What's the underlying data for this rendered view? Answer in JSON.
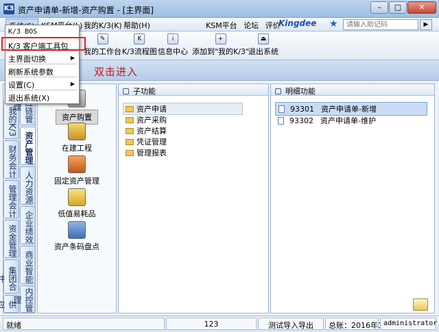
{
  "window": {
    "title": "资产申请单-新增-资产购置 - [主界面]",
    "app_icon": "K3",
    "buttons": {
      "minimize": "–",
      "maximize": "□",
      "close": "✕"
    }
  },
  "menubar": {
    "items": [
      "系统(S)",
      "KSM平台(L)",
      "我的K/3(K)",
      "帮助(H)"
    ],
    "links": [
      "KSM平台",
      "论坛",
      "评价"
    ],
    "brand": "Kingdee",
    "help_placeholder": "请输入助记码"
  },
  "dropdown": {
    "items": [
      {
        "label": "K/3 BOS",
        "submenu": false
      },
      {
        "label": "K/3 客户端工具包",
        "submenu": false
      },
      {
        "label": "主界面切换",
        "submenu": true
      },
      {
        "label": "刷新系统参数",
        "submenu": false
      },
      {
        "label": "设置(C)",
        "submenu": true
      },
      {
        "label": "退出系统(X)",
        "submenu": false
      }
    ]
  },
  "toolbar": {
    "items": [
      "我的工作台",
      "K/3流程图",
      "信息中心",
      "添加到\"我的K/3\"",
      "退出系统"
    ]
  },
  "annotation": "双击进入",
  "left_tabs": {
    "col1": [
      "我的K/3",
      "财务会计",
      "管理会计",
      "资金管理",
      "集团合并",
      "供应链"
    ],
    "col2": [
      "资产管理",
      "人力资源",
      "企业绩效",
      "商业智能",
      "内控管理"
    ],
    "top": "供应链管理"
  },
  "modules": [
    "资产购置",
    "在建工程",
    "固定资产管理",
    "低值易耗品",
    "资产条码盘点"
  ],
  "subfunctions": {
    "header": "子功能",
    "items": [
      "资产申请",
      "资产采购",
      "资产结算",
      "凭证管理",
      "管理报表"
    ]
  },
  "details": {
    "header": "明细功能",
    "items": [
      {
        "code": "93301",
        "name": "资产申请单-新增"
      },
      {
        "code": "93302",
        "name": "资产申请单-维护"
      }
    ]
  },
  "statusbar": {
    "status": "就绪",
    "count": "123",
    "mode": "测试导入导出",
    "period": "总账：2016年1期",
    "user": "administrator"
  }
}
